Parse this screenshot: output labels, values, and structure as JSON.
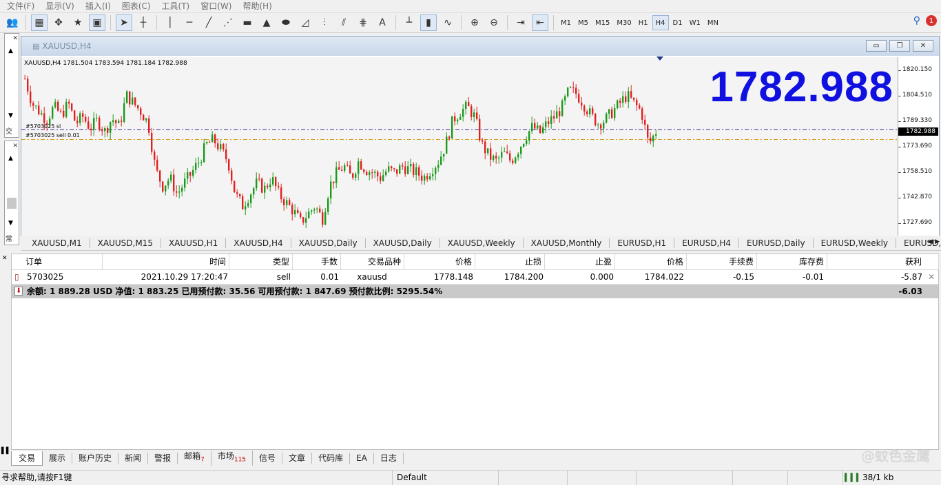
{
  "menu": [
    "文件(F)",
    "显示(V)",
    "插入(I)",
    "图表(C)",
    "工具(T)",
    "窗口(W)",
    "帮助(H)"
  ],
  "toolbar": {
    "timeframes": [
      "M1",
      "M5",
      "M15",
      "M30",
      "H1",
      "H4",
      "D1",
      "W1",
      "MN"
    ],
    "active_timeframe": "H4",
    "text_tool": "A",
    "notification_count": "1"
  },
  "nav": {
    "tab_trade": "交",
    "tab_common": "常"
  },
  "chart": {
    "window_title": "XAUUSD,H4",
    "ohlc_label": "XAUUSD,H4  1781.504 1783.594 1781.184 1782.988",
    "big_price": "1782.988",
    "current_price_box": "1782.988",
    "order_label_1": "#5703025 sl",
    "order_label_2": "#5703025 sell 0.01",
    "price_ticks": [
      "1820.150",
      "1804.510",
      "1789.330",
      "1773.690",
      "1758.510",
      "1742.870",
      "1727.690"
    ]
  },
  "chart_data": {
    "type": "candlestick",
    "symbol": "XAUUSD",
    "timeframe": "H4",
    "ylim": [
      1720.0,
      1828.0
    ],
    "y_ticks": [
      1820.15,
      1804.51,
      1789.33,
      1773.69,
      1758.51,
      1742.87,
      1727.69
    ],
    "last": {
      "open": 1781.504,
      "high": 1783.594,
      "low": 1781.184,
      "close": 1782.988
    },
    "sl_line": 1784.2,
    "entry_line": 1778.148,
    "close_path": [
      1815,
      1800,
      1795,
      1790,
      1798,
      1793,
      1800,
      1788,
      1792,
      1785,
      1790,
      1783,
      1791,
      1786,
      1805,
      1800,
      1795,
      1788,
      1760,
      1750,
      1755,
      1745,
      1752,
      1758,
      1765,
      1775,
      1778,
      1772,
      1765,
      1745,
      1738,
      1745,
      1752,
      1748,
      1755,
      1745,
      1740,
      1735,
      1728,
      1733,
      1738,
      1730,
      1750,
      1758,
      1762,
      1755,
      1765,
      1760,
      1758,
      1755,
      1760,
      1758,
      1762,
      1760,
      1758,
      1755,
      1760,
      1765,
      1775,
      1790,
      1795,
      1798,
      1792,
      1775,
      1768,
      1765,
      1770,
      1765,
      1772,
      1780,
      1786,
      1782,
      1788,
      1792,
      1797,
      1808,
      1806,
      1800,
      1793,
      1788,
      1790,
      1795,
      1800,
      1805,
      1800,
      1795,
      1775,
      1783
    ]
  },
  "chart_tabs": [
    "XAUUSD,M1",
    "XAUUSD,M15",
    "XAUUSD,H1",
    "XAUUSD,H4",
    "XAUUSD,Daily",
    "XAUUSD,Daily",
    "XAUUSD,Weekly",
    "XAUUSD,Monthly",
    "EURUSD,H1",
    "EURUSD,H4",
    "EURUSD,Daily",
    "EURUSD,Weekly",
    "EURUSD,"
  ],
  "terminal": {
    "columns": [
      "订单",
      "时间",
      "类型",
      "手数",
      "交易品种",
      "价格",
      "止损",
      "止盈",
      "价格",
      "手续费",
      "库存费",
      "获利"
    ],
    "row": {
      "order": "5703025",
      "time": "2021.10.29 17:20:47",
      "type": "sell",
      "lots": "0.01",
      "symbol": "xauusd",
      "open_price": "1778.148",
      "sl": "1784.200",
      "tp": "0.000",
      "price": "1784.022",
      "commission": "-0.15",
      "swap": "-0.01",
      "profit": "-5.87"
    },
    "summary": "余额: 1 889.28 USD  净值: 1 883.25  已用预付款: 35.56  可用预付款: 1 847.69  预付款比例: 5295.54%",
    "summary_total": "-6.03"
  },
  "terminal_tabs": [
    {
      "label": "交易",
      "count": ""
    },
    {
      "label": "展示",
      "count": ""
    },
    {
      "label": "账户历史",
      "count": ""
    },
    {
      "label": "新闻",
      "count": ""
    },
    {
      "label": "警报",
      "count": ""
    },
    {
      "label": "邮箱",
      "count": "7"
    },
    {
      "label": "市场",
      "count": "115"
    },
    {
      "label": "信号",
      "count": ""
    },
    {
      "label": "文章",
      "count": ""
    },
    {
      "label": "代码库",
      "count": ""
    },
    {
      "label": "EA",
      "count": ""
    },
    {
      "label": "日志",
      "count": ""
    }
  ],
  "watermark": "@蚊色金鹰",
  "status": {
    "help": "寻求帮助,请按F1键",
    "profile": "Default",
    "traffic": "38/1 kb"
  }
}
